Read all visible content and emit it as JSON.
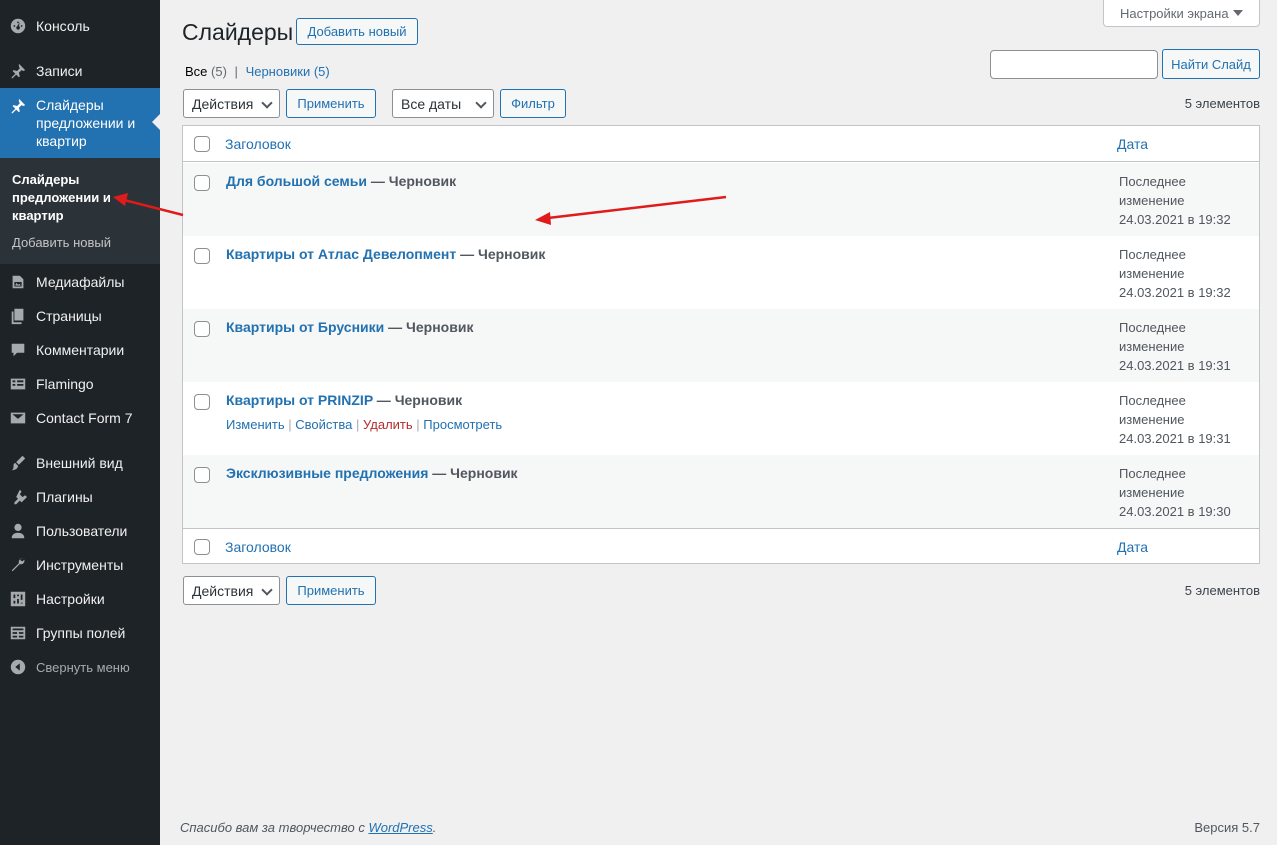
{
  "sidebar": {
    "items": [
      {
        "label": "Консоль",
        "icon": "dashboard-icon"
      },
      {
        "label": "Записи",
        "icon": "pin-icon"
      },
      {
        "label": "Слайдеры предложении и квартир",
        "icon": "pin-icon"
      },
      {
        "label": "Медиафайлы",
        "icon": "media-icon"
      },
      {
        "label": "Страницы",
        "icon": "pages-icon"
      },
      {
        "label": "Комментарии",
        "icon": "comment-icon"
      },
      {
        "label": "Flamingo",
        "icon": "flamingo-icon"
      },
      {
        "label": "Contact Form 7",
        "icon": "mail-icon"
      },
      {
        "label": "Внешний вид",
        "icon": "brush-icon"
      },
      {
        "label": "Плагины",
        "icon": "plugin-icon"
      },
      {
        "label": "Пользователи",
        "icon": "user-icon"
      },
      {
        "label": "Инструменты",
        "icon": "wrench-icon"
      },
      {
        "label": "Настройки",
        "icon": "settings-icon"
      },
      {
        "label": "Группы полей",
        "icon": "fields-icon"
      },
      {
        "label": "Свернуть меню",
        "icon": "collapse-icon"
      }
    ],
    "submenu": {
      "current": "Слайдеры предложении и квартир",
      "add_new": "Добавить новый"
    }
  },
  "header": {
    "title": "Слайдеры",
    "add_new": "Добавить новый",
    "screen_options": "Настройки экрана"
  },
  "filters": {
    "all_label": "Все",
    "all_count": "(5)",
    "separator": "|",
    "drafts_label": "Черновики",
    "drafts_count": "(5)",
    "bulk_actions": "Действия",
    "apply": "Применить",
    "all_dates": "Все даты",
    "filter": "Фильтр",
    "search_button": "Найти Слайд",
    "search_value": "",
    "items_count": "5 элементов"
  },
  "table": {
    "col_title": "Заголовок",
    "col_date": "Дата",
    "status_sep": " — ",
    "rows": [
      {
        "title": "Для большой семьи",
        "status": "Черновик",
        "date_label": "Последнее изменение",
        "date": "24.03.2021 в 19:32"
      },
      {
        "title": "Квартиры от Атлас Девелопмент",
        "status": "Черновик",
        "date_label": "Последнее изменение",
        "date": "24.03.2021 в 19:32"
      },
      {
        "title": "Квартиры от Брусники",
        "status": "Черновик",
        "date_label": "Последнее изменение",
        "date": "24.03.2021 в 19:31"
      },
      {
        "title": "Квартиры от PRINZIP",
        "status": "Черновик",
        "date_label": "Последнее изменение",
        "date": "24.03.2021 в 19:31"
      },
      {
        "title": "Эксклюзивные предложения",
        "status": "Черновик",
        "date_label": "Последнее изменение",
        "date": "24.03.2021 в 19:30"
      }
    ],
    "row_actions": {
      "edit": "Изменить",
      "props": "Свойства",
      "delete": "Удалить",
      "view": "Просмотреть",
      "sep": "|"
    }
  },
  "footer": {
    "thanks_prefix": "Спасибо вам за творчество с ",
    "thanks_link": "WordPress",
    "thanks_suffix": ".",
    "version": "Версия 5.7"
  },
  "colors": {
    "admin_bar": "#1d2327",
    "accent": "#2271b1",
    "annotation_arrow": "#e01b1b",
    "delete": "#b32d2e"
  }
}
